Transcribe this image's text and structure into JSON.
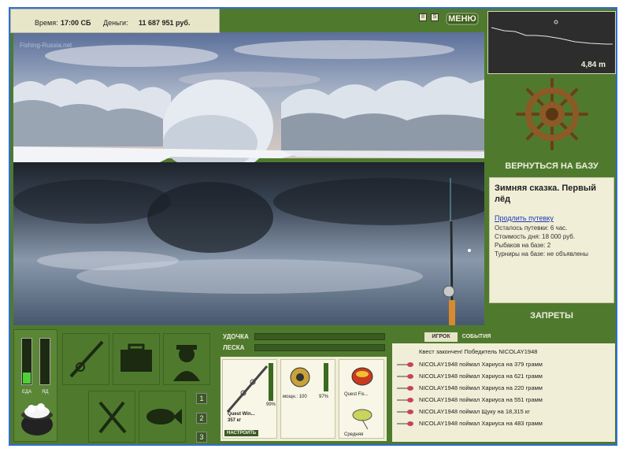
{
  "status": {
    "time_label": "Время:",
    "time_value": "17:00 СБ",
    "money_label": "Деньги:",
    "money_value": "11 687 951 руб."
  },
  "top_icons": {
    "pause": "II",
    "sound": "S"
  },
  "menu_label": "МЕНЮ",
  "watermark": "Fishing-Russia.net",
  "depth": {
    "value": "4,84 m"
  },
  "base": {
    "return_label": "ВЕРНУТЬСЯ НА БАЗУ"
  },
  "info": {
    "title": "Зимняя сказка. Первый лёд",
    "extend_link": "Продлить путевку",
    "lines": [
      "Осталось путевки: 6 час.",
      "Стоимость дня: 18 000 руб.",
      "Рыбаков на базе: 2",
      "Турниры на базе: не объявлены"
    ]
  },
  "bans_label": "ЗАПРЕТЫ",
  "gauges": {
    "food_label": "ЕДА",
    "poison_label": "ЯД",
    "food_level": 0.25,
    "poison_level": 0.0
  },
  "inventory": {
    "pages": [
      "1",
      "2",
      "3"
    ],
    "active_page": 0
  },
  "tackle": {
    "rod_label": "УДОЧКА",
    "line_label": "ЛЕСКА",
    "rod_name": "Quest Win...",
    "rod_weight": "357 кг",
    "rod_condition": "99%",
    "setup_button": "НАСТРОИТЬ",
    "reel_power": "мощн.: 100",
    "reel_condition": "97%",
    "bait_name": "Quest Fis...",
    "lure_size": "Средняя"
  },
  "events": {
    "tab_player": "ИГРОК",
    "tab_events": "СОБЫТИЯ",
    "quest_line": "Квест закончен! Победитель NICOLAY1948",
    "catches": [
      "NICOLAY1948 поймал Хариуса на 379 грамм",
      "NICOLAY1948 поймал Хариуса на 621 грамм",
      "NICOLAY1948 поймал Хариуса на 220 грамм",
      "NICOLAY1948 поймал Хариуса на 551 грамм",
      "NICOLAY1948 поймал Щуку на 18,315 кг",
      "NICOLAY1948 поймал Хариуса на 483 грамм"
    ]
  }
}
